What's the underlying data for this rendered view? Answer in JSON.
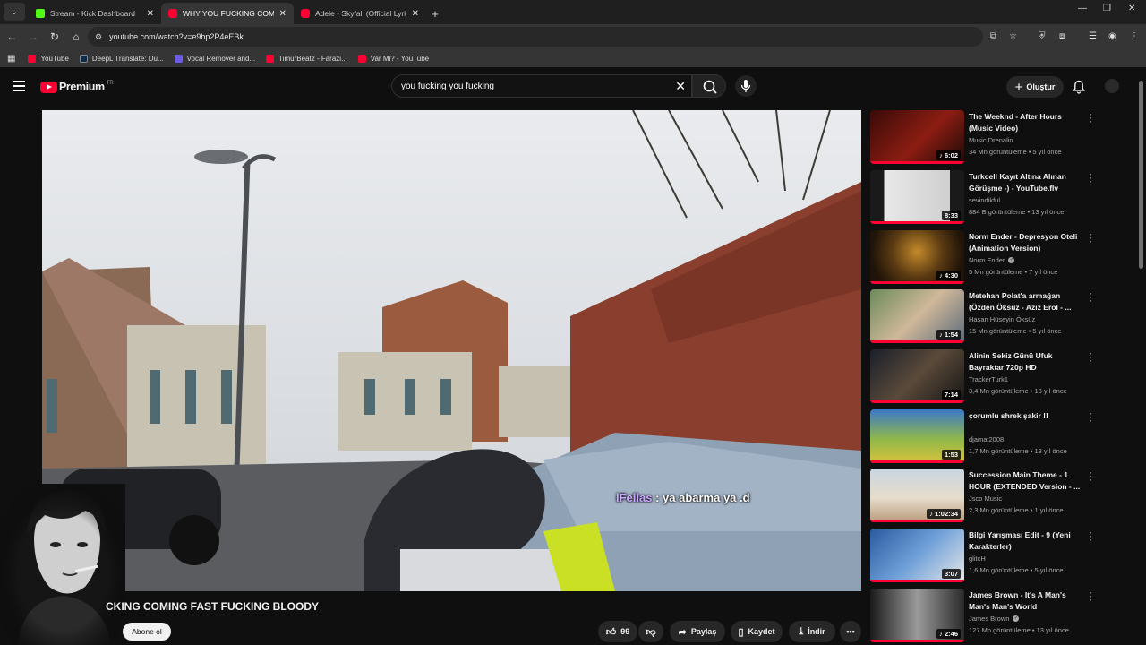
{
  "browser": {
    "tabs": [
      {
        "title": "Stream - Kick Dashboard",
        "favicon": "kick-icon",
        "active": false
      },
      {
        "title": "WHY YOU FUCKING COMING F",
        "favicon": "youtube-icon",
        "active": true
      },
      {
        "title": "Adele - Skyfall (Official Lyric Vid",
        "favicon": "youtube-icon",
        "active": false
      }
    ],
    "url": "youtube.com/watch?v=e9bp2P4eEBk",
    "bookmarks": [
      {
        "label": "YouTube",
        "color": "#ff0033"
      },
      {
        "label": "DeepL Translate: Dü...",
        "color": "#0f2b46"
      },
      {
        "label": "Vocal Remover and...",
        "color": "#6c5ce7"
      },
      {
        "label": "TimurBeatz - Farazi...",
        "color": "#ff0033"
      },
      {
        "label": "Var Mi? - YouTube",
        "color": "#ff0033"
      }
    ]
  },
  "header": {
    "logo_text": "Premium",
    "country": "TR",
    "search_query": "you fucking you fucking",
    "create_label": "Oluştur"
  },
  "video": {
    "title": "CKING COMING FAST FUCKING BLOODY",
    "chat_user": "iFelias",
    "chat_text": " : ya abarma ya .d",
    "subscribe_label": "Abone ol",
    "likes": "99",
    "share_label": "Paylaş",
    "save_label": "Kaydet",
    "download_label": "İndir"
  },
  "recommendations": [
    {
      "title": "The Weeknd - After Hours (Music Video)",
      "channel": "Music Drenalin",
      "verified": false,
      "meta": "34 Mn görüntüleme • 5 yıl önce",
      "duration": "6:02",
      "music": true
    },
    {
      "title": "Turkcell Kayıt Altına Alınan Görüşme -) - YouTube.flv",
      "channel": "sevindikful",
      "verified": false,
      "meta": "884 B görüntüleme • 13 yıl önce",
      "duration": "8:33",
      "music": false
    },
    {
      "title": "Norm Ender - Depresyon Oteli (Animation Version)",
      "channel": "Norm Ender",
      "verified": true,
      "meta": "5 Mn görüntüleme • 7 yıl önce",
      "duration": "4:30",
      "music": true
    },
    {
      "title": "Metehan Polat'a armağan (Özden Öksüz - Aziz Erol - ...",
      "channel": "Hasan Hüseyin Öksüz",
      "verified": false,
      "meta": "15 Mn görüntüleme • 5 yıl önce",
      "duration": "1:54",
      "music": true
    },
    {
      "title": "Alinin Sekiz Günü Ufuk Bayraktar 720p HD",
      "channel": "TrackerTurk1",
      "verified": false,
      "meta": "3,4 Mn görüntüleme • 13 yıl önce",
      "duration": "7:14",
      "music": false
    },
    {
      "title": "çorumlu shrek şakir !!",
      "channel": "djamat2008",
      "verified": false,
      "meta": "1,7 Mn görüntüleme • 18 yıl önce",
      "duration": "1:53",
      "music": false
    },
    {
      "title": "Succession Main Theme - 1 HOUR (EXTENDED Version - ...",
      "channel": "Jsco Music",
      "verified": false,
      "meta": "2,3 Mn görüntüleme • 1 yıl önce",
      "duration": "1:02:34",
      "music": true
    },
    {
      "title": "Bilgi Yarışması Edit - 9 (Yeni Karakterler)",
      "channel": "glitcH",
      "verified": false,
      "meta": "1,6 Mn görüntüleme • 5 yıl önce",
      "duration": "3:07",
      "music": false
    },
    {
      "title": "James Brown - It's A Man's Man's Man's World",
      "channel": "James Brown",
      "verified": true,
      "meta": "127 Mn görüntüleme • 13 yıl önce",
      "duration": "2:46",
      "music": true
    }
  ],
  "colors": {
    "youtube_red": "#ff0033",
    "kick_green": "#53fc18",
    "bg": "#0f0f0f"
  }
}
